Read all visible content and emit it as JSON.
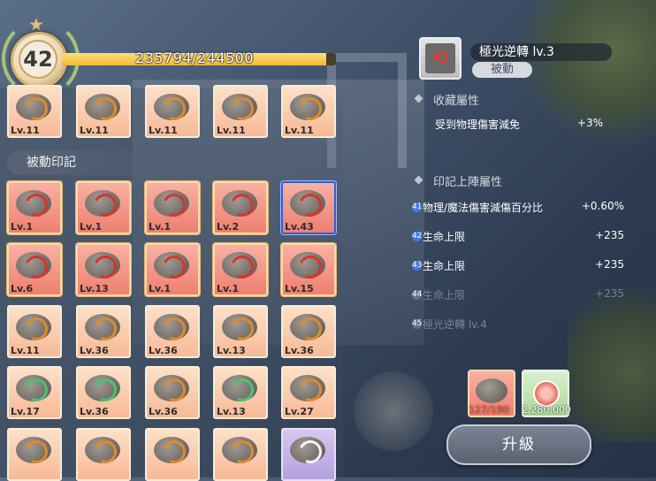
{
  "header": {
    "level": "42",
    "xp_text": "235794/244500",
    "xp_progress": 0.964
  },
  "grid": {
    "top_row": [
      {
        "level": "Lv.11",
        "rarity": "orange"
      },
      {
        "level": "Lv.11",
        "rarity": "orange"
      },
      {
        "level": "Lv.11",
        "rarity": "orange"
      },
      {
        "level": "Lv.11",
        "rarity": "orange"
      },
      {
        "level": "Lv.11",
        "rarity": "orange"
      }
    ],
    "section_title": "被動印記",
    "rows": [
      [
        {
          "level": "Lv.1",
          "rarity": "red"
        },
        {
          "level": "Lv.1",
          "rarity": "red"
        },
        {
          "level": "Lv.1",
          "rarity": "red"
        },
        {
          "level": "Lv.2",
          "rarity": "red"
        },
        {
          "level": "Lv.43",
          "rarity": "red",
          "selected": true
        }
      ],
      [
        {
          "level": "Lv.6",
          "rarity": "red"
        },
        {
          "level": "Lv.13",
          "rarity": "red"
        },
        {
          "level": "Lv.1",
          "rarity": "red"
        },
        {
          "level": "Lv.1",
          "rarity": "red"
        },
        {
          "level": "Lv.15",
          "rarity": "red"
        }
      ],
      [
        {
          "level": "Lv.11",
          "rarity": "orange"
        },
        {
          "level": "Lv.36",
          "rarity": "orange"
        },
        {
          "level": "Lv.36",
          "rarity": "orange"
        },
        {
          "level": "Lv.13",
          "rarity": "orange"
        },
        {
          "level": "Lv.36",
          "rarity": "orange"
        }
      ],
      [
        {
          "level": "Lv.17",
          "rarity": "orange",
          "glyph": "green"
        },
        {
          "level": "Lv.36",
          "rarity": "orange",
          "glyph": "green"
        },
        {
          "level": "Lv.36",
          "rarity": "orange"
        },
        {
          "level": "Lv.13",
          "rarity": "orange",
          "glyph": "green"
        },
        {
          "level": "Lv.27",
          "rarity": "orange"
        }
      ],
      [
        {
          "level": "",
          "rarity": "orange"
        },
        {
          "level": "",
          "rarity": "orange"
        },
        {
          "level": "",
          "rarity": "orange"
        },
        {
          "level": "",
          "rarity": "orange"
        },
        {
          "level": "",
          "rarity": "purple"
        }
      ]
    ]
  },
  "skill": {
    "name": "極光逆轉 lv.3",
    "tag": "被動",
    "icon": "aurora-reversal-icon"
  },
  "collection": {
    "title": "收藏屬性",
    "attributes": [
      {
        "label": "受到物理傷害減免",
        "value": "+3%"
      }
    ]
  },
  "deploy": {
    "title": "印記上陣屬性",
    "rows": [
      {
        "num": "41",
        "label": "物理/魔法傷害減傷百分比",
        "value": "+0.60%",
        "dim": false
      },
      {
        "num": "42",
        "label": "生命上限",
        "value": "+235",
        "dim": false
      },
      {
        "num": "43",
        "label": "生命上限",
        "value": "+235",
        "dim": false
      },
      {
        "num": "44",
        "label": "生命上限",
        "value": "+235",
        "dim": true
      },
      {
        "num": "45",
        "label": "極光逆轉 lv.4",
        "value": "",
        "dim": true
      }
    ]
  },
  "cost": {
    "rune_count": "127/190",
    "coin_count": "2,280,000"
  },
  "upgrade_label": "升級",
  "colors": {
    "xp_fill": "#f1b935",
    "selected_border": "#2f5fd9",
    "level_dot": "#3e7ae6"
  }
}
